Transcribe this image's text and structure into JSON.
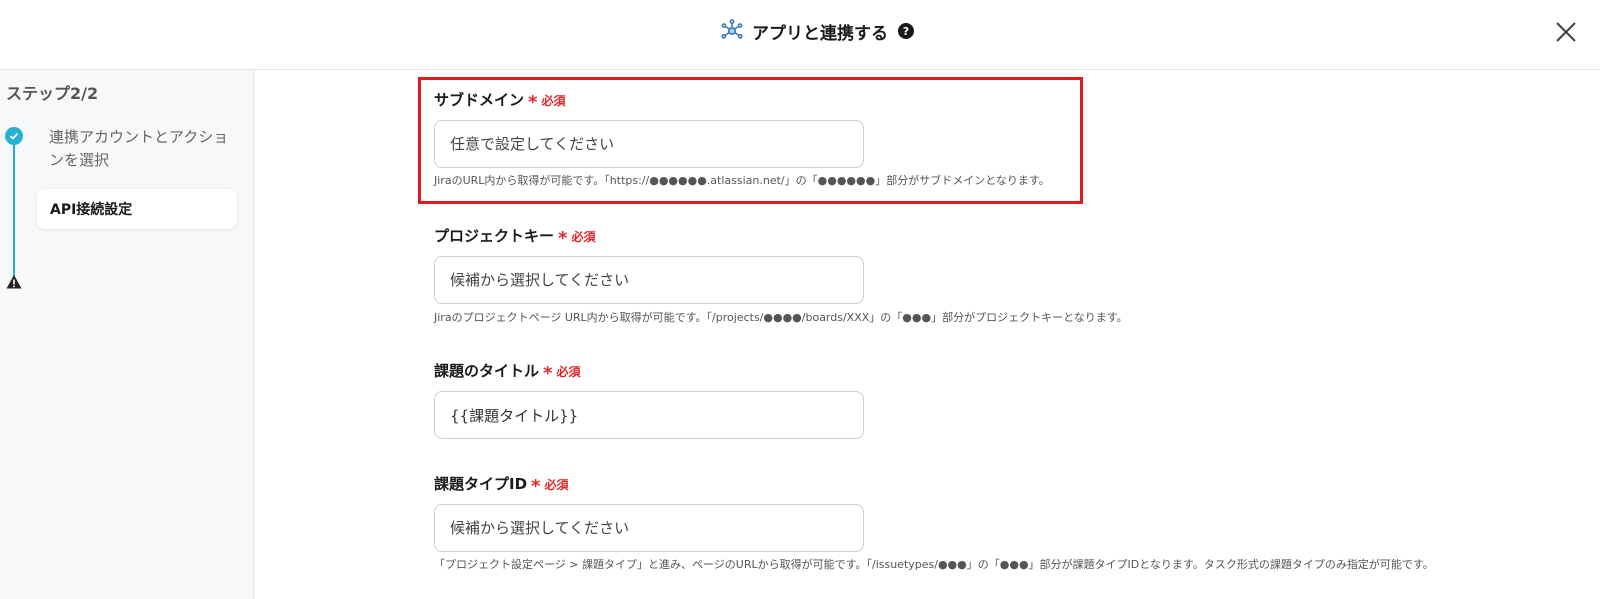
{
  "header": {
    "title": "アプリと連携する",
    "help_symbol": "?"
  },
  "sidebar": {
    "step_header": "ステップ2/2",
    "steps": [
      {
        "label": "連携アカウントとアクションを選択",
        "status": "complete"
      },
      {
        "label": "API接続設定",
        "status": "warning"
      }
    ]
  },
  "colors": {
    "accent": "#25b0d6",
    "required": "#e2262a",
    "highlight": "#e01b1b"
  },
  "form": {
    "fields": [
      {
        "label": "サブドメイン",
        "required_star": "*",
        "required_text": "必須",
        "placeholder": "任意で設定してください",
        "value": "",
        "hint": "JiraのURL内から取得が可能です。「https://●●●●●●.atlassian.net/」の「●●●●●●」部分がサブドメインとなります。"
      },
      {
        "label": "プロジェクトキー",
        "required_star": "*",
        "required_text": "必須",
        "placeholder": "候補から選択してください",
        "value": "",
        "hint": "Jiraのプロジェクトページ URL内から取得が可能です。「/projects/●●●●/boards/XXX」の「●●●」部分がプロジェクトキーとなります。"
      },
      {
        "label": "課題のタイトル",
        "required_star": "*",
        "required_text": "必須",
        "placeholder": "",
        "value": "{{課題タイトル}}",
        "hint": ""
      },
      {
        "label": "課題タイプID",
        "required_star": "*",
        "required_text": "必須",
        "placeholder": "候補から選択してください",
        "value": "",
        "hint": "「プロジェクト設定ページ > 課題タイプ」と進み、ページのURLから取得が可能です。「/issuetypes/●●●」の「●●●」部分が課題タイプIDとなります。タスク形式の課題タイプのみ指定が可能です。"
      }
    ]
  }
}
